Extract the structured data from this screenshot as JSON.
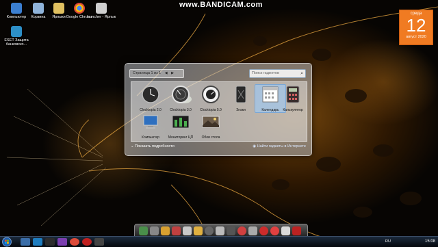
{
  "watermark": "www.BANDICAM.com",
  "desktop": {
    "icons": [
      {
        "label": "Компьютер",
        "icon": "computer-icon",
        "color": "#3b7fd1"
      },
      {
        "label": "Корзина",
        "icon": "recycle-bin-icon",
        "color": "#8fb3d9"
      },
      {
        "label": "Ярлыки",
        "icon": "shortcuts-icon",
        "color": "#e0c060"
      },
      {
        "label": "Google Chrome",
        "icon": "chrome-icon",
        "color": "#dd4b39"
      },
      {
        "label": "launcher - Ярлык",
        "icon": "launcher-icon",
        "color": "#cfcfcf"
      },
      {
        "label": "ESET Защита банковско...",
        "icon": "eset-icon",
        "color": "#2d8fc7"
      }
    ]
  },
  "calendar_gadget": {
    "weekday": "среда",
    "day": "12",
    "month_year": "август 2020",
    "color": "#f07b22"
  },
  "gadget_window": {
    "pager": "Страница 1 из 1",
    "search_placeholder": "Поиск гаджетов",
    "gadgets": [
      {
        "label": "Clocktopia 2.0",
        "icon": "clock-icon"
      },
      {
        "label": "Clocktopia 3.0",
        "icon": "clock-icon"
      },
      {
        "label": "Clocktopia 5.0",
        "icon": "clock-icon"
      },
      {
        "label": "Знаки",
        "icon": "signs-icon"
      },
      {
        "label": "Календарь",
        "icon": "calendar-icon",
        "selected": true
      },
      {
        "label": "Калькулятор",
        "icon": "calculator-icon"
      },
      {
        "label": "Компьютер",
        "icon": "computer-icon"
      },
      {
        "label": "Мониторинг ЦП",
        "icon": "cpu-monitor-icon"
      },
      {
        "label": "Обои стола",
        "icon": "wallpaper-icon"
      }
    ],
    "details_label": "Показать подробности",
    "more_label": "Найти гаджеты в Интернете"
  },
  "dock": {
    "icons": [
      "app-icon",
      "app-icon",
      "app-icon",
      "app-icon",
      "app-icon",
      "app-icon",
      "app-icon",
      "app-icon",
      "app-icon",
      "app-icon",
      "app-icon",
      "app-icon",
      "app-icon",
      "app-icon",
      "app-icon",
      "app-icon"
    ]
  },
  "taskbar": {
    "lang": "RU",
    "time": "15:08"
  },
  "colors": {
    "accent": "#f07b22",
    "taskbar": "#0b1420"
  }
}
